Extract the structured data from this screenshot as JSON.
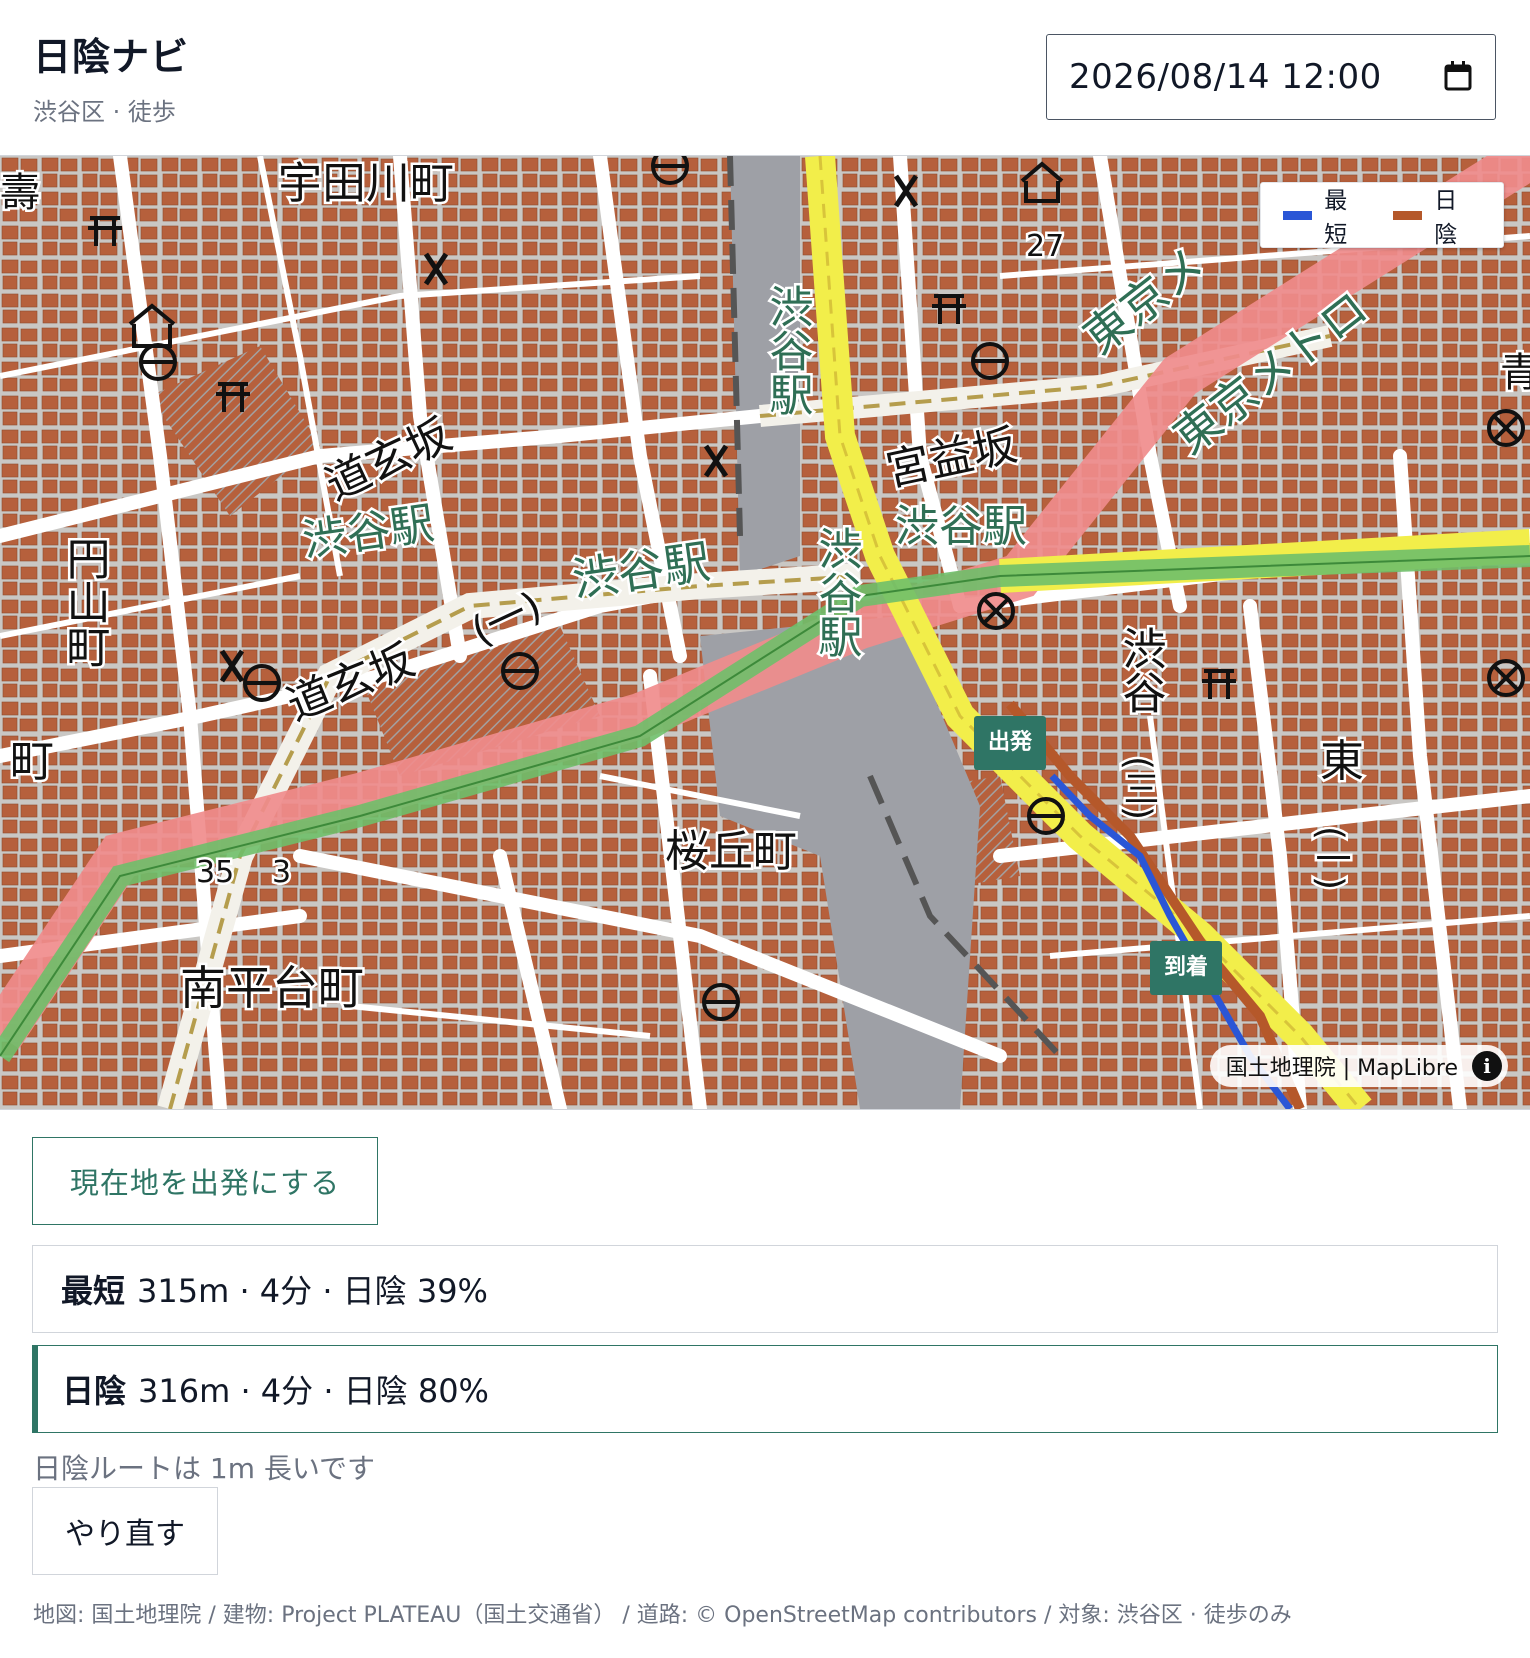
{
  "header": {
    "title": "日陰ナビ",
    "subtitle": "渋谷区 · 徒歩",
    "datetime_value": "2026/08/14 12:00"
  },
  "map": {
    "legend": {
      "shortest_label": "最短",
      "shade_label": "日陰",
      "shortest_color": "#2a56d6",
      "shade_color": "#b5582a"
    },
    "start_label": "出発",
    "end_label": "到着",
    "attribution": "国土地理院 | MapLibre",
    "info_symbol": "i",
    "labels": {
      "udagawa": "宇田川町",
      "dogenzaka": "道玄坂",
      "dogenzaka2": "道玄坂",
      "shibuya_st1": "渋谷駅",
      "shibuya_st2": "渋谷駅",
      "shibuya_st3": "渋谷駅",
      "shibuya_v1": "渋谷駅",
      "shibuya_v2": "渋谷駅",
      "miyamasuzaka": "宮益坂",
      "sakuragaoka": "桜丘町",
      "nanpeidai": "南平台町",
      "maruyama": "円山町",
      "tokyo_metro1": "東京メ",
      "tokyo_metro2": "東京メトロ",
      "higashi": "東",
      "shibuya_area": "渋谷",
      "dogenzaka_sub": "(一)",
      "san": "(三)",
      "ichi": "(一)",
      "num27": "27",
      "num35": "35",
      "num3": "3",
      "ao": "青",
      "machi": "町",
      "kotobuki": "壽"
    },
    "colors": {
      "buildings": "#b6603c",
      "roads": "#ffffff",
      "expressway": "#f08c8c",
      "national_road": "#f2ee4a",
      "rail": "#6fbf6a",
      "station_area": "#9ea0a6"
    }
  },
  "actions": {
    "use_location_label": "現在地を出発にする",
    "redo_label": "やり直す"
  },
  "routes": [
    {
      "name": "最短",
      "detail": "315m · 4分 · 日陰 39%"
    },
    {
      "name": "日陰",
      "detail": "316m · 4分 · 日陰 80%"
    }
  ],
  "diff_note": "日陰ルートは 1m 長いです",
  "footer": "地図: 国土地理院 / 建物: Project PLATEAU（国土交通省） / 道路: © OpenStreetMap contributors / 対象: 渋谷区 · 徒歩のみ"
}
